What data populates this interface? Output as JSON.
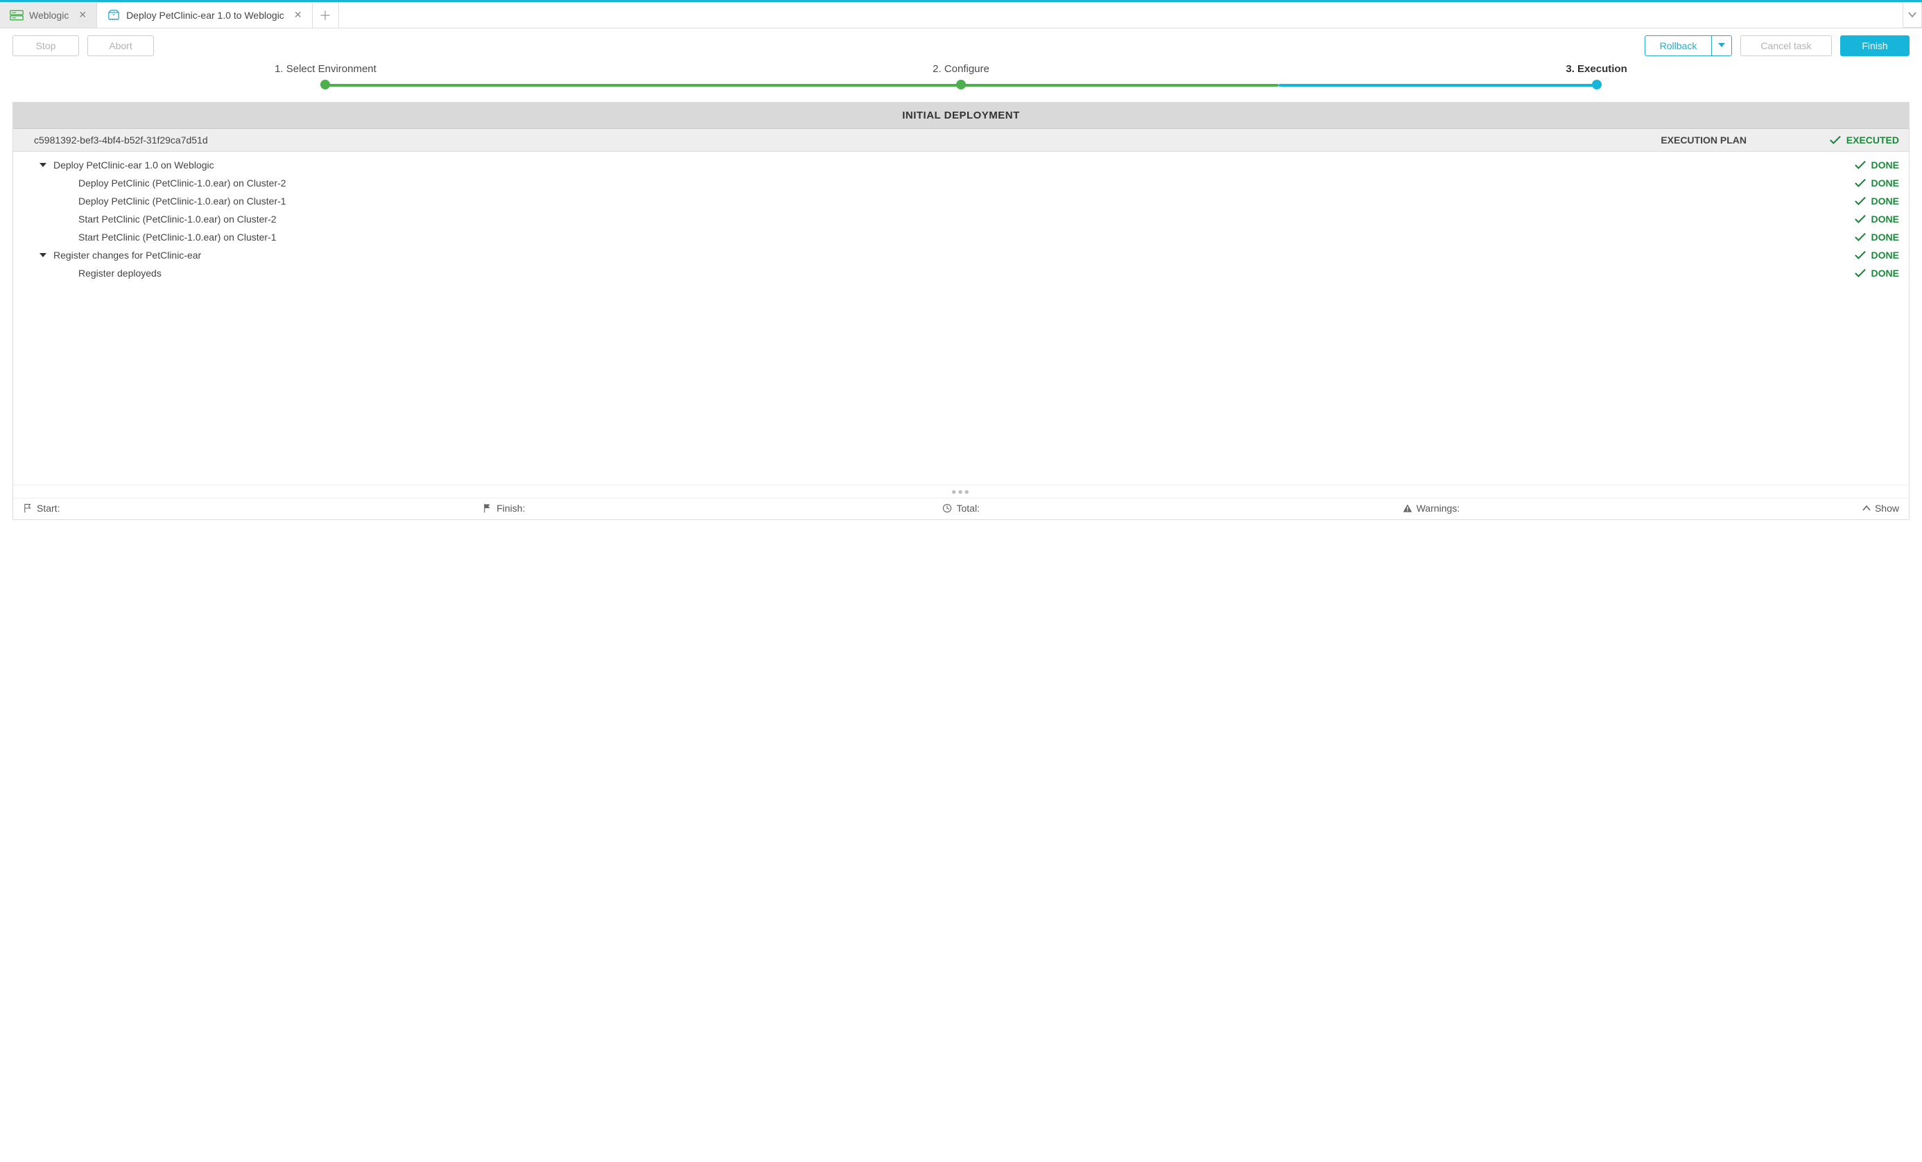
{
  "tabs": {
    "weblogic": "Weblogic",
    "deploy": "Deploy PetClinic-ear 1.0 to Weblogic"
  },
  "actions": {
    "stop": "Stop",
    "abort": "Abort",
    "rollback": "Rollback",
    "cancel": "Cancel task",
    "finish": "Finish"
  },
  "steps": {
    "s1": "1. Select Environment",
    "s2": "2. Configure",
    "s3": "3. Execution"
  },
  "banner": "INITIAL DEPLOYMENT",
  "execHeader": {
    "id": "c5981392-bef3-4bf4-b52f-31f29ca7d51d",
    "title": "EXECUTION PLAN",
    "status": "EXECUTED"
  },
  "rows": [
    {
      "indent": 1,
      "caret": true,
      "label": "Deploy PetClinic-ear 1.0 on Weblogic",
      "status": "DONE"
    },
    {
      "indent": 2,
      "caret": false,
      "label": "Deploy PetClinic (PetClinic-1.0.ear) on Cluster-2",
      "status": "DONE"
    },
    {
      "indent": 2,
      "caret": false,
      "label": "Deploy PetClinic (PetClinic-1.0.ear) on Cluster-1",
      "status": "DONE"
    },
    {
      "indent": 2,
      "caret": false,
      "label": "Start PetClinic (PetClinic-1.0.ear) on Cluster-2",
      "status": "DONE"
    },
    {
      "indent": 2,
      "caret": false,
      "label": "Start PetClinic (PetClinic-1.0.ear) on Cluster-1",
      "status": "DONE"
    },
    {
      "indent": 1,
      "caret": true,
      "label": "Register changes for PetClinic-ear",
      "status": "DONE"
    },
    {
      "indent": 2,
      "caret": false,
      "label": "Register deployeds",
      "status": "DONE"
    }
  ],
  "footer": {
    "start": "Start:",
    "finish": "Finish:",
    "total": "Total:",
    "warnings": "Warnings:",
    "show": "Show"
  }
}
